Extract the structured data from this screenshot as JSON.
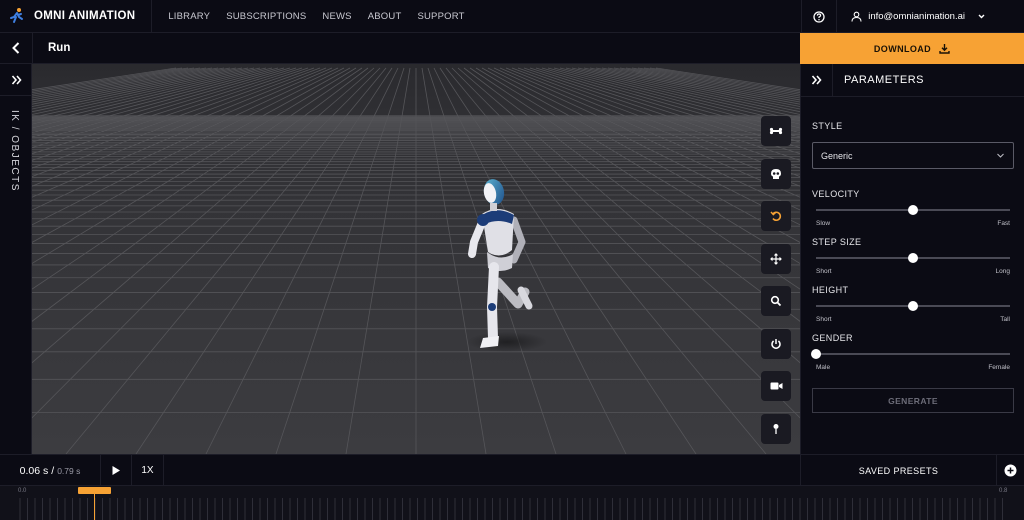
{
  "header": {
    "brand": "OMNI ANIMATION",
    "nav": [
      "LIBRARY",
      "SUBSCRIPTIONS",
      "NEWS",
      "ABOUT",
      "SUPPORT"
    ],
    "user_email": "info@omnianimation.ai",
    "icons": {
      "logo": "running-figure-icon",
      "help": "help-icon",
      "user": "user-icon",
      "dropdown": "chevron-down-icon"
    }
  },
  "title_bar": {
    "animation_name": "Run"
  },
  "download": {
    "label": "DOWNLOAD"
  },
  "left_panel": {
    "label": "IK / OBJECTS"
  },
  "viewport_tools": [
    "bone-icon",
    "skull-icon",
    "reset-rotate-icon",
    "move-icon",
    "zoom-icon",
    "power-icon",
    "camera-icon",
    "pin-icon"
  ],
  "parameters": {
    "title": "PARAMETERS",
    "style": {
      "label": "STYLE",
      "value": "Generic"
    },
    "sliders": [
      {
        "label": "VELOCITY",
        "min_label": "Slow",
        "max_label": "Fast",
        "value": 0.5
      },
      {
        "label": "STEP SIZE",
        "min_label": "Short",
        "max_label": "Long",
        "value": 0.5
      },
      {
        "label": "HEIGHT",
        "min_label": "Short",
        "max_label": "Tall",
        "value": 0.5
      },
      {
        "label": "GENDER",
        "min_label": "Male",
        "max_label": "Female",
        "value": 0.0
      }
    ],
    "generate_label": "GENERATE"
  },
  "playback": {
    "current_time": "0.06 s",
    "separator": "/",
    "total_time": "0.79 s",
    "speed": "1X",
    "saved_presets_label": "SAVED PRESETS",
    "progress": 0.076
  },
  "timeline": {
    "start_label": "0.0",
    "end_label": "0.8"
  },
  "colors": {
    "accent": "#f7a234",
    "background": "#0b0b14",
    "viewport": "#333337"
  }
}
